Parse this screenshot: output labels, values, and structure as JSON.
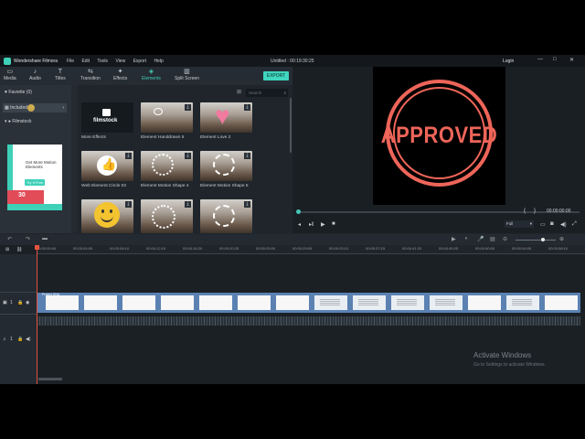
{
  "titlebar": {
    "app_name": "Wondershare Filmora",
    "menus": [
      "File",
      "Edit",
      "Tools",
      "View",
      "Export",
      "Help"
    ],
    "project": "Untitled : 00:19:30:25",
    "login": "Login",
    "window_buttons": [
      "—",
      "□",
      "✕"
    ]
  },
  "toolbar": {
    "tools": [
      {
        "label": "Media",
        "icon": "folder-icon"
      },
      {
        "label": "Audio",
        "icon": "music-note-icon"
      },
      {
        "label": "Titles",
        "icon": "text-icon"
      },
      {
        "label": "Transition",
        "icon": "transition-icon"
      },
      {
        "label": "Effects",
        "icon": "effects-icon"
      },
      {
        "label": "Elements",
        "icon": "elements-icon",
        "active": true
      },
      {
        "label": "Split Screen",
        "icon": "split-screen-icon"
      }
    ],
    "export_label": "EXPORT"
  },
  "sidebar": {
    "favorite": "Favorite (0)",
    "included": "Included (9)",
    "filmstock": "Filmstock",
    "promo": {
      "headline": "Get More Motion Elements",
      "button": "Try It Free",
      "badge": "30"
    }
  },
  "library": {
    "search_placeholder": "Search",
    "items": [
      {
        "caption": "More Effects",
        "style": "filmstock",
        "logo_text": "filmstock"
      },
      {
        "caption": "Element Handdrawn 5",
        "style": "photo"
      },
      {
        "caption": "Element Love 2",
        "style": "photo-heart"
      },
      {
        "caption": "Web Element Circle 03",
        "style": "photo-thumb"
      },
      {
        "caption": "Element Motion Shape 4",
        "style": "photo-burst"
      },
      {
        "caption": "Element Motion Shape 5",
        "style": "photo-burst"
      },
      {
        "caption": "",
        "style": "photo-smiley"
      },
      {
        "caption": "",
        "style": "photo-burst"
      },
      {
        "caption": "",
        "style": "photo"
      }
    ]
  },
  "preview": {
    "stamp_text": "APPROVED",
    "timecode": "00:00:00:00",
    "quality": "Full",
    "stamp_color": "#ee6559"
  },
  "timeline": {
    "ruler": [
      "00:00:00:00",
      "00:00:04:05",
      "00:00:08:10",
      "00:00:12:15",
      "00:00:16:20",
      "00:00:20:25",
      "00:00:25:00",
      "00:00:29:05",
      "00:00:33:10",
      "00:00:37:15",
      "00:00:41:20",
      "00:00:45:25",
      "00:00:50:00",
      "00:00:54:05",
      "00:00:58:10"
    ],
    "video_track_label": "1",
    "audio_track_label": "1",
    "clip_label": "Project DNA_"
  },
  "os": {
    "watermark_title": "Activate Windows",
    "watermark_sub": "Go to Settings to activate Windows."
  }
}
